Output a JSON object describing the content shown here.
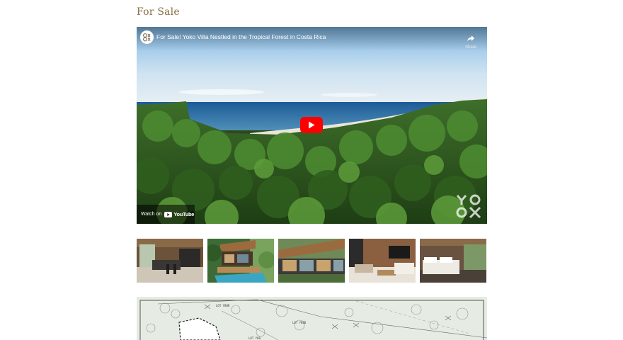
{
  "section": {
    "title": "For Sale"
  },
  "video": {
    "title": "For Sale! Yoko Villa Nestled in the Tropical Forest in Costa Rica",
    "share_label": "Share",
    "watch_on_label": "Watch on",
    "youtube_label": "YouTube",
    "icons": [
      "channel-logo-icon",
      "share-icon",
      "play-icon",
      "youtube-icon",
      "yoko-logo-icon"
    ],
    "colors": {
      "play_button": "#ff0000",
      "title_text": "#ffffff"
    }
  },
  "gallery": {
    "thumbnails": [
      {
        "name": "thumbnail-kitchen"
      },
      {
        "name": "thumbnail-pool-deck"
      },
      {
        "name": "thumbnail-facade"
      },
      {
        "name": "thumbnail-living-room"
      },
      {
        "name": "thumbnail-bedroom"
      }
    ]
  },
  "site_map": {
    "lot_labels": [
      "LOT Y80R",
      "LOT Y80D",
      "LOT Y80"
    ]
  },
  "colors": {
    "section_title": "#8a6d44",
    "map_background": "#e6ece3"
  }
}
